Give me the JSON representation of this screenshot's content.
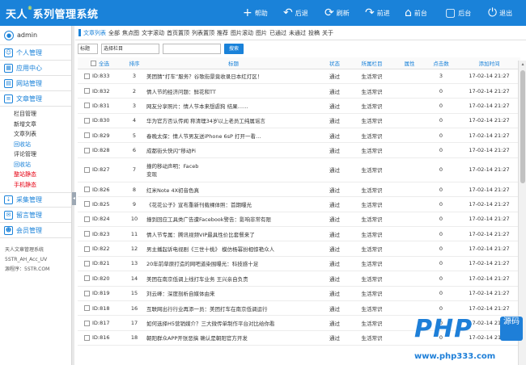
{
  "app": {
    "title": "天人",
    "title_sup": "®",
    "title_rest": "系列管理系统"
  },
  "topnav": [
    {
      "label": "帮助",
      "icon": "+"
    },
    {
      "label": "后退",
      "icon": "↶"
    },
    {
      "label": "刷新",
      "icon": "⟳"
    },
    {
      "label": "前进",
      "icon": "↷"
    },
    {
      "label": "前台",
      "icon": "⌂"
    },
    {
      "label": "后台",
      "icon": "▢"
    },
    {
      "label": "退出",
      "icon": "⏻"
    }
  ],
  "sidebar": {
    "user": "admin",
    "menus": [
      {
        "label": "个人管理"
      },
      {
        "label": "应用中心"
      },
      {
        "label": "网站管理"
      },
      {
        "label": "文章管理"
      }
    ],
    "submenu": [
      {
        "label": "栏目管理",
        "style": ""
      },
      {
        "label": "新增文章",
        "style": ""
      },
      {
        "label": "文章列表",
        "style": ""
      },
      {
        "label": "回收站",
        "style": "blue"
      },
      {
        "label": "评论管理",
        "style": ""
      },
      {
        "label": "回收站",
        "style": "blue"
      },
      {
        "label": "整站静态",
        "style": "red"
      },
      {
        "label": "手机静态",
        "style": "red"
      }
    ],
    "menus2": [
      {
        "label": "采集管理"
      },
      {
        "label": "留言管理"
      },
      {
        "label": "会员管理"
      }
    ],
    "footer": [
      "天人文章管理系统",
      "5STR_AH_Acc_UV",
      "源程序：5STR.COM"
    ]
  },
  "breadcrumb": [
    "文章列表",
    "全部",
    "焦点图",
    "文字滚动",
    "首页置顶",
    "列表置顶",
    "推荐",
    "图片滚动",
    "图片",
    "已通过",
    "未通过",
    "投稿",
    "关于"
  ],
  "filter": {
    "field": "标题",
    "category": "选择栏目",
    "search_label": "搜索"
  },
  "table": {
    "headers": [
      "全选",
      "排序",
      "标题",
      "状态",
      "所属栏目",
      "属性",
      "点击数",
      "添加时间"
    ],
    "rows": [
      {
        "id": "ID:833",
        "sort": "3",
        "title": "美团猜“打车”服务？谷歌街景竟收录日本红灯区！",
        "status": "通过",
        "cat": "生活常识",
        "attr": "",
        "hits": "3",
        "time": "17-02-14 21:27"
      },
      {
        "id": "ID:832",
        "sort": "2",
        "title": "情人节的经济问题：鲜花和TT",
        "status": "通过",
        "cat": "生活常识",
        "attr": "",
        "hits": "0",
        "time": "17-02-14 21:27"
      },
      {
        "id": "ID:831",
        "sort": "3",
        "title": "网友分享照片：情人节本来想虐狗 结果……",
        "status": "通过",
        "cat": "生活常识",
        "attr": "",
        "hits": "0",
        "time": "17-02-14 21:27"
      },
      {
        "id": "ID:830",
        "sort": "4",
        "title": "华为官方否认传闻 称清理34岁以上老员工纯属谣言",
        "status": "通过",
        "cat": "生活常识",
        "attr": "",
        "hits": "0",
        "time": "17-02-14 21:27"
      },
      {
        "id": "ID:829",
        "sort": "5",
        "title": "春晚太保：情人节男友送iPhone 6sP 打开一看…",
        "status": "通过",
        "cat": "生活常识",
        "attr": "",
        "hits": "0",
        "time": "17-02-14 21:27"
      },
      {
        "id": "ID:828",
        "sort": "6",
        "title": "成都街头快闪“移动Pi",
        "status": "通过",
        "cat": "生活常识",
        "attr": "",
        "hits": "0",
        "time": "17-02-14 21:27"
      },
      {
        "id": "ID:827",
        "sort": "7",
        "title": "撞的移动声明：Faceb",
        "title2": "变现",
        "status": "通过",
        "cat": "生活常识",
        "attr": "",
        "hits": "0",
        "time": "17-02-14 21:27"
      },
      {
        "id": "ID:826",
        "sort": "8",
        "title": "红米Note 4X初音色真",
        "status": "通过",
        "cat": "生活常识",
        "attr": "",
        "hits": "0",
        "time": "17-02-14 21:27"
      },
      {
        "id": "ID:825",
        "sort": "9",
        "title": "《花花公子》宣布重新刊载裸体照：首期曝光",
        "status": "通过",
        "cat": "生活常识",
        "attr": "",
        "hits": "0",
        "time": "17-02-14 21:27"
      },
      {
        "id": "ID:824",
        "sort": "10",
        "title": "撞到回应工具类广告遭Facebook警告：影响非常有限",
        "status": "通过",
        "cat": "生活常识",
        "attr": "",
        "hits": "0",
        "time": "17-02-14 21:27"
      },
      {
        "id": "ID:823",
        "sort": "11",
        "title": "情人节专属：腾讯视频VIP最具性价比套餐来了",
        "status": "通过",
        "cat": "生活常识",
        "attr": "",
        "hits": "0",
        "time": "17-02-14 21:27"
      },
      {
        "id": "ID:822",
        "sort": "12",
        "title": "男主播起诉电视剧《三世十桃》 模仿杨幂扮相惊艳众人",
        "status": "通过",
        "cat": "生活常识",
        "attr": "",
        "hits": "0",
        "time": "17-02-14 21:27"
      },
      {
        "id": "ID:821",
        "sort": "13",
        "title": "20年前草原打造的网吧道染围曝光：科技感十足",
        "status": "通过",
        "cat": "生活常识",
        "attr": "",
        "hits": "0",
        "time": "17-02-14 21:27"
      },
      {
        "id": "ID:820",
        "sort": "14",
        "title": "美团在南京低调上线打车业务 王兴亲自负责",
        "status": "通过",
        "cat": "生活常识",
        "attr": "",
        "hits": "0",
        "time": "17-02-14 21:27"
      },
      {
        "id": "ID:819",
        "sort": "15",
        "title": "刘云峰：深度剖析自媒体由来",
        "status": "通过",
        "cat": "生活常识",
        "attr": "",
        "hits": "0",
        "time": "17-02-14 21:27"
      },
      {
        "id": "ID:818",
        "sort": "16",
        "title": "互联网出行行业再添一员：美团打车在南京低调运行",
        "status": "通过",
        "cat": "生活常识",
        "attr": "",
        "hits": "0",
        "time": "17-02-14 21:27"
      },
      {
        "id": "ID:817",
        "sort": "17",
        "title": "如何选择H5营销媒介？三大微传单制作平台对比给你看",
        "status": "通过",
        "cat": "生活常识",
        "attr": "",
        "hits": "0",
        "time": "17-02-14 21:27"
      },
      {
        "id": "ID:816",
        "sort": "18",
        "title": "朝阳群众APP开张恶搞 确认是朝阳官方开发",
        "status": "通过",
        "cat": "生活常识",
        "attr": "",
        "hits": "0",
        "time": "17-02-14 21:27"
      }
    ]
  },
  "watermark": {
    "brand": "PHP",
    "ym": "源码",
    "url": "www.php333.com"
  }
}
